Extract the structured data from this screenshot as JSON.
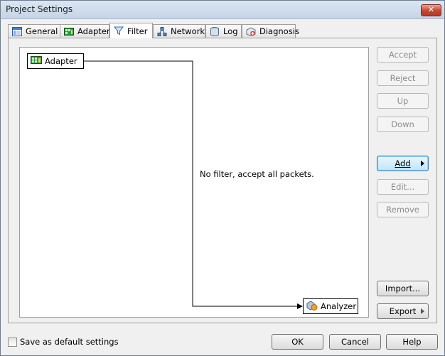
{
  "window": {
    "title": "Project Settings",
    "close_glyph": "✕"
  },
  "tabs": [
    {
      "label": "General",
      "icon": "general-icon",
      "active": false
    },
    {
      "label": "Adapter",
      "icon": "adapter-icon",
      "active": false
    },
    {
      "label": "Filter",
      "icon": "filter-icon",
      "active": true
    },
    {
      "label": "Network",
      "icon": "network-icon",
      "active": false
    },
    {
      "label": "Log",
      "icon": "log-icon",
      "active": false
    },
    {
      "label": "Diagnosis",
      "icon": "diagnosis-icon",
      "active": false
    }
  ],
  "filter_graph": {
    "source_node": "Adapter",
    "target_node": "Analyzer",
    "message": "No filter, accept all packets."
  },
  "side_buttons": {
    "accept": "Accept",
    "reject": "Reject",
    "up": "Up",
    "down": "Down",
    "add": "Add",
    "edit": "Edit...",
    "remove": "Remove",
    "import": "Import...",
    "export": "Export"
  },
  "footer": {
    "save_default": "Save as default settings",
    "save_default_checked": false,
    "ok": "OK",
    "cancel": "Cancel",
    "help": "Help"
  },
  "colors": {
    "title_bar": "#c5d4e7",
    "close_button": "#c6442f",
    "focus_border": "#3c7fb1"
  }
}
